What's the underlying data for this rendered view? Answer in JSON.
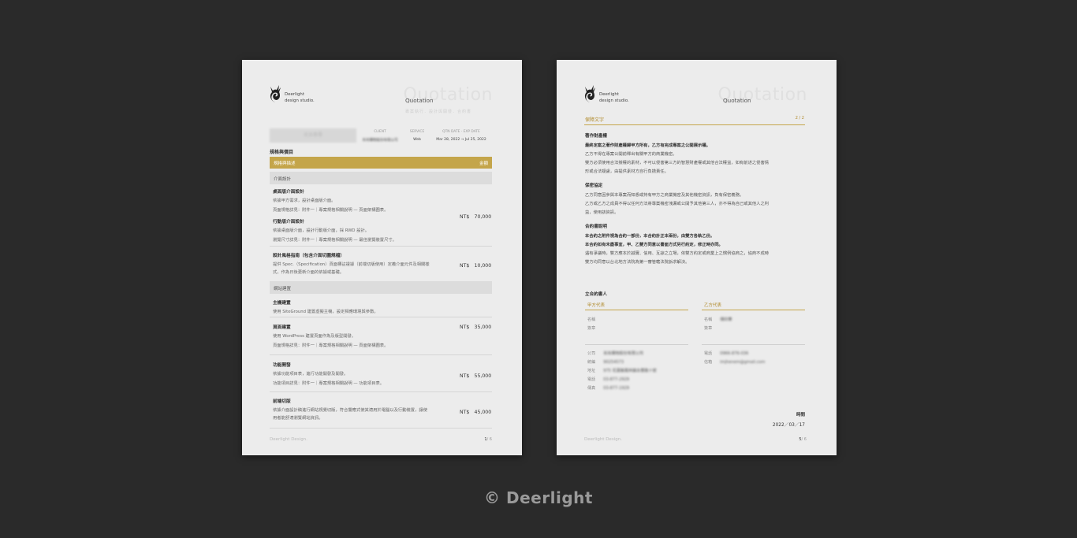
{
  "brand": {
    "name_line1": "Deerlight",
    "name_line2": "design studio."
  },
  "page1": {
    "quote_watermark": "Quotation",
    "quote_label": "Quotation",
    "subtitle": "專案執行．設計與開發．合約書",
    "client_name": "吳吳春雅",
    "meta": [
      {
        "label": "CLIENT",
        "value": "肖肖購物股份有限公司"
      },
      {
        "label": "SERVICE",
        "value": "Web"
      },
      {
        "label": "QTN DATE · EXP DATE",
        "value": "Mar 28, 2022 → Jul 25, 2022"
      }
    ],
    "section_title": "規格與價目",
    "table_head": {
      "left": "規格與描述",
      "right": "金額"
    },
    "group1": "介面設計",
    "items1": [
      {
        "title": "桌面版介面設計",
        "lines": [
          "依據甲方需求，設計桌面版介面。",
          "頁面規格詳見：附件一｜專案規格相關說明 — 頁面架構圖表。"
        ]
      },
      {
        "title": "行動版介面設計",
        "lines": [
          "依據桌面版介面，設計行動版介面，採 RWD 設計。",
          "瀏覽尺寸詳見：附件一｜專案規格相關說明 — 最佳瀏覽裝置尺寸。"
        ]
      },
      {
        "title": "設計風格指南（包含介面切圖規檔）",
        "lines": [
          "提供 Spec.（Specification）頁面標註證據（前端切版使用）定義介面元件及相關樣",
          "式，作為日後更新介面的依據或基礎。"
        ]
      }
    ],
    "price1": "NT$　70,000",
    "price2": "NT$　10,000",
    "group2": "網站建置",
    "items2": [
      {
        "title": "主機建置",
        "lines": [
          "使用 SiteGround 建置虛擬主機，設定相應環境與參數。"
        ]
      },
      {
        "title": "頁面建置",
        "lines": [
          "使用 WordPress 建置頁面作為及版型開發。",
          "頁面規格詳見：附件一｜專案規格相關說明 — 頁面架構圖表。"
        ]
      },
      {
        "title": "功能開發",
        "lines": [
          "依據功能項目表，進行功能開發及開發。",
          "功能項目詳見：附件一｜專案規格相關說明 — 功能項目表。"
        ]
      },
      {
        "title": "前端切版",
        "lines": [
          "依據介面設計稿進行網站視覺切版，符合響應式使其適用於電腦以及行動裝置，讓使",
          "用者能舒適瀏覽網站資訊。"
        ]
      }
    ],
    "price3": "NT$　35,000",
    "price4": "NT$　55,000",
    "price5": "NT$　45,000",
    "footer_left": "Deerlight Design.",
    "footer_page": "1",
    "footer_total": "/ 6"
  },
  "page2": {
    "quote_watermark": "Quotation",
    "quote_label": "Quotation",
    "section_left": "保障文字",
    "section_right": "2 / 2",
    "clauses": [
      {
        "title": "著作財產權",
        "lines": [
          {
            "t": "最終定案之著作財產權歸甲方所有，乙方有完成專案之公開展示權。",
            "b": true
          },
          {
            "t": "乙方不得在專案公開前釋出有關甲方的商業機密。",
            "b": false
          },
          {
            "t": "雙方必須使用合法授權的素材，不可以侵害第三方的智慧財產權或其他合法權益，如有前述之侵害情",
            "b": false
          },
          {
            "t": "形或合法疑慮，由提供素材方自行負擔責任。",
            "b": false
          }
        ]
      },
      {
        "title": "保密協定",
        "lines": [
          {
            "t": "乙方同意因參與本專案而知悉或持有甲方之商業機密及其他機密資訊，負有保密義務。",
            "b": false
          },
          {
            "t": "乙方或乙方之成員不得以任何方法將專案機密洩漏或公開予其他第三人，亦不得為自己或其他人之利",
            "b": false
          },
          {
            "t": "益，使用該資訊。",
            "b": false
          }
        ]
      },
      {
        "title": "合約書說明",
        "lines": [
          {
            "t": "本合約之附件視為合約一部份，本合約計正本兩份，由雙方各執乙份。",
            "b": true
          },
          {
            "t": "本合約如有未盡事宜，甲、乙雙方同意以書面方式另行約定，修正時亦同。",
            "b": true
          },
          {
            "t": "遇有爭議時，雙方應本於誠實、信用、互諒之立場，依雙方約定或商業上之慣例協商之，協商不成時",
            "b": false
          },
          {
            "t": "雙方均同意以台北地方法院為第一審管轄法院訴求解決。",
            "b": false
          }
        ]
      }
    ],
    "signer_title": "立合約書人",
    "party_a": "甲方代表",
    "party_b": "乙方代表",
    "a_fields": [
      {
        "k": "名稱",
        "v": ""
      },
      {
        "k": "簽章",
        "v": ""
      }
    ],
    "b_fields": [
      {
        "k": "名稱",
        "v": "傳欣華"
      },
      {
        "k": "簽章",
        "v": ""
      }
    ],
    "a_details": [
      {
        "k": "公司",
        "v": "肖肖購物股份有限公司"
      },
      {
        "k": "統編",
        "v": "90254573"
      },
      {
        "k": "地址",
        "v": "975 花蓮縣鳳林鎮永豐路十號"
      },
      {
        "k": "電話",
        "v": "03-877-2929"
      },
      {
        "k": "傳真",
        "v": "03-877-1929"
      }
    ],
    "b_details": [
      {
        "k": "電話",
        "v": "0966-876-036"
      },
      {
        "k": "信箱",
        "v": "imjhenem@gmail.com"
      }
    ],
    "date_label": "時間",
    "date_value": "2022／03／17",
    "footer_left": "Deerlight Design.",
    "footer_page": "5",
    "footer_total": "/ 6"
  },
  "copyright": "© Deerlight"
}
